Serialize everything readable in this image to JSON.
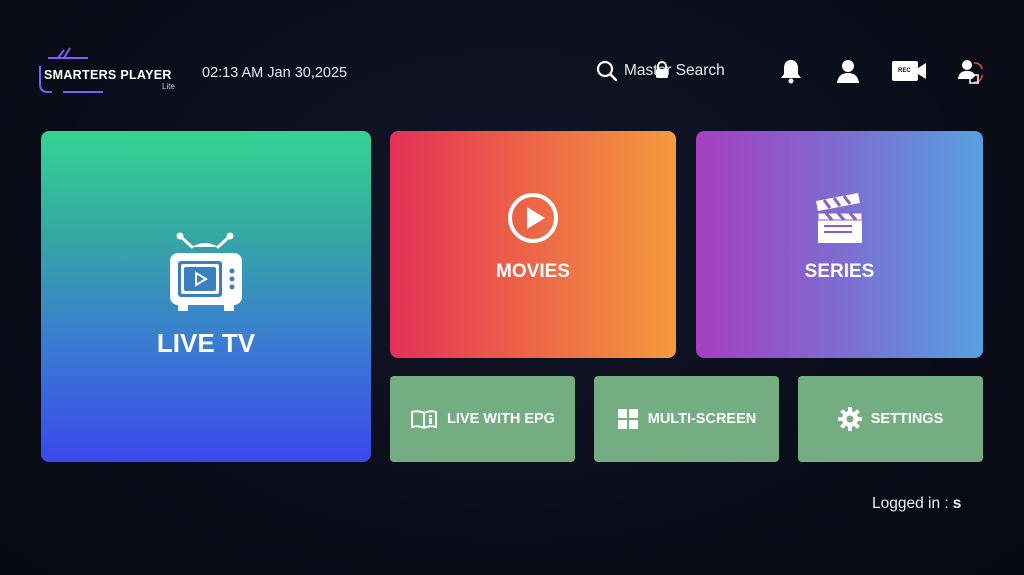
{
  "header": {
    "logo_text": "SMARTERS PLAYER",
    "logo_sub": "Lite",
    "datetime": "02:13 AM  Jan 30,2025",
    "search_label": "Master Search",
    "icons": [
      "search-icon",
      "lock-icon",
      "bell-icon",
      "user-icon",
      "rec-camera-icon",
      "switch-user-icon"
    ],
    "rec_text": "REC"
  },
  "tiles": {
    "live_tv": "LIVE TV",
    "movies": "MOVIES",
    "series": "SERIES",
    "live_epg": "LIVE WITH EPG",
    "multi_screen": "MULTI-SCREEN",
    "settings": "SETTINGS"
  },
  "footer": {
    "logged_label": "Logged in :",
    "logged_user": "s"
  },
  "colors": {
    "background": "#0b0e1b",
    "small_tile": "#74ad82",
    "logo_accent": "#7b5cff"
  }
}
